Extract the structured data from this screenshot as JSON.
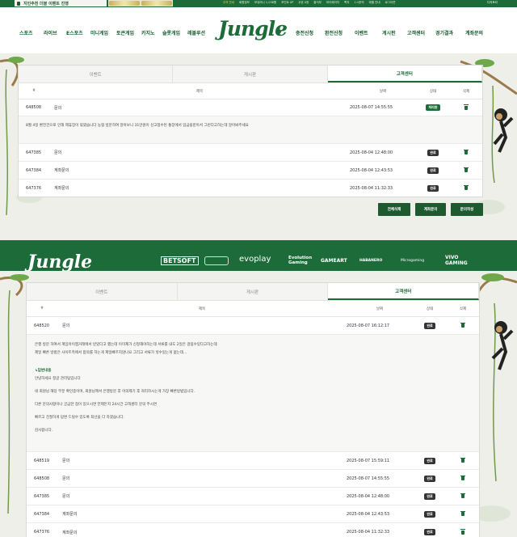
{
  "topbar": {
    "promo": "지인추천 더블 이벤트 진행",
    "links": [
      "주의 안내",
      "회원정보",
      "보유머니 1,038원",
      "포인트 0P",
      "쿠폰 0장",
      "출석부",
      "마이페이지",
      "쪽지",
      "1:1문의",
      "레벨 안내",
      "로그아웃"
    ],
    "logout": "디지토리"
  },
  "nav": {
    "left": [
      "스포츠",
      "라이브",
      "E스포츠",
      "미니게임",
      "토큰게임",
      "카지노",
      "슬롯게임",
      "레볼루션"
    ],
    "right": [
      "충전신청",
      "환전신청",
      "이벤트",
      "게시판",
      "고객센터",
      "경기결과",
      "계좌문의"
    ],
    "logo": "Jungle"
  },
  "panel1": {
    "tabs": [
      "이벤트",
      "게시판",
      "고객센터"
    ],
    "headers": {
      "num": "#",
      "title": "제목",
      "date": "날짜",
      "status": "상태",
      "del": "삭제"
    },
    "first": {
      "num": "648508",
      "title": "문의",
      "date": "2025-08-07 14:55:55",
      "status": "처리완"
    },
    "first_body": "8월 4일 환전건으로 인해 제휴장이 묶였습니다 농협 방문하여 알아보니 31만원이 신고접수된 통장에서 입금을받아서 그런다고하는데 알아봐주세요",
    "rows": [
      {
        "num": "647385",
        "title": "문의",
        "date": "2025-08-04 12:48:00",
        "status": "완료"
      },
      {
        "num": "647384",
        "title": "계좌문의",
        "date": "2025-08-04 12:43:53",
        "status": "완료"
      },
      {
        "num": "647376",
        "title": "계좌문의",
        "date": "2025-08-04 11:32:33",
        "status": "완료"
      }
    ],
    "buttons": [
      "전체삭제",
      "계좌문의",
      "문의작성"
    ]
  },
  "footer": {
    "logo": "Jungle",
    "providers": [
      "BETSOFT",
      "evoplay",
      "Evolution Gaming",
      "GAMEART",
      "HABANERO",
      "Microgaming",
      "VIVO GAMING"
    ]
  },
  "panel2": {
    "tabs": [
      "이벤트",
      "게시판",
      "고객센터"
    ],
    "headers": {
      "num": "#",
      "title": "제목",
      "date": "날짜",
      "status": "상태",
      "del": "삭제"
    },
    "first": {
      "num": "648520",
      "title": "문의",
      "date": "2025-08-07 16:12:17",
      "status": "완료"
    },
    "question": [
      "은행 방문 하여서 계임아이엠거래에서 받았다고 했는데 이미제가 신청해야하는데 서류를 내도 2일은 걸림수있다고하는데",
      "제일 빠른 방법은 사이트측에서 합의를 하는게 제일빠르지않나요  그리고 서류가 넣수있는게 없는데..."
    ],
    "answer_title": "↳답변내용",
    "answer": [
      "안녕하세요 정글 관리팀입니다",
      "네 회원님 해당 부분 확인중이며, 회원님께서 은행방문 후 이의제기 후 처리하시는게 가장 빠른방법입니다.",
      "다른 문의사항이나 궁금한 점이 있으시면 언제든지 24시간 고객센터 문의 주시면",
      "빠르고 친절하게 답변 드릴수 있도록 최선을 다 하겠습니다.",
      "감사합니다."
    ],
    "rows": [
      {
        "num": "648519",
        "title": "문의",
        "date": "2025-08-07 15:59:11",
        "status": "완료"
      },
      {
        "num": "648508",
        "title": "문의",
        "date": "2025-08-07 14:55:55",
        "status": "완료"
      },
      {
        "num": "647385",
        "title": "문의",
        "date": "2025-08-04 12:48:00",
        "status": "완료"
      },
      {
        "num": "647384",
        "title": "계좌문의",
        "date": "2025-08-04 12:43:53",
        "status": "완료"
      },
      {
        "num": "647376",
        "title": "계좌문의",
        "date": "2025-08-04 11:32:33",
        "status": "완료"
      }
    ]
  },
  "colors": {
    "brand": "#1e6b3a",
    "badge": "#333333"
  }
}
